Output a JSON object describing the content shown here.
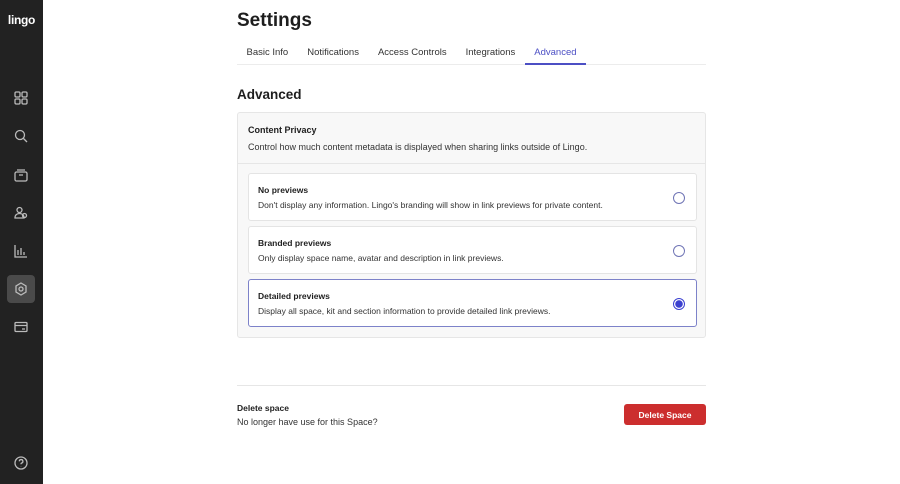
{
  "app": {
    "logo": "lingo"
  },
  "sidebar": {
    "items": [
      {
        "icon": "grid-icon"
      },
      {
        "icon": "search-icon"
      },
      {
        "icon": "archive-icon"
      },
      {
        "icon": "users-icon"
      },
      {
        "icon": "chart-icon"
      },
      {
        "icon": "gear-icon",
        "active": true
      },
      {
        "icon": "credit-card-icon"
      },
      {
        "icon": "help-icon"
      }
    ]
  },
  "header": {
    "title": "Settings"
  },
  "tabs": [
    {
      "label": "Basic Info"
    },
    {
      "label": "Notifications"
    },
    {
      "label": "Access Controls"
    },
    {
      "label": "Integrations"
    },
    {
      "label": "Advanced",
      "active": true
    }
  ],
  "section": {
    "title": "Advanced",
    "card": {
      "title": "Content Privacy",
      "description": "Control how much content metadata is displayed when sharing links outside of Lingo.",
      "options": [
        {
          "title": "No previews",
          "description": "Don't display any information. Lingo's branding will show in link previews for private content.",
          "selected": false
        },
        {
          "title": "Branded previews",
          "description": "Only display space name, avatar and description in link previews.",
          "selected": false
        },
        {
          "title": "Detailed previews",
          "description": "Display all space, kit and section information to provide detailed link previews.",
          "selected": true
        }
      ]
    }
  },
  "delete": {
    "title": "Delete space",
    "description": "No longer have use for this Space?",
    "button": "Delete Space"
  },
  "colors": {
    "accent": "#4c4fc4",
    "danger": "#cc2e2e",
    "sidebar": "#222222"
  }
}
